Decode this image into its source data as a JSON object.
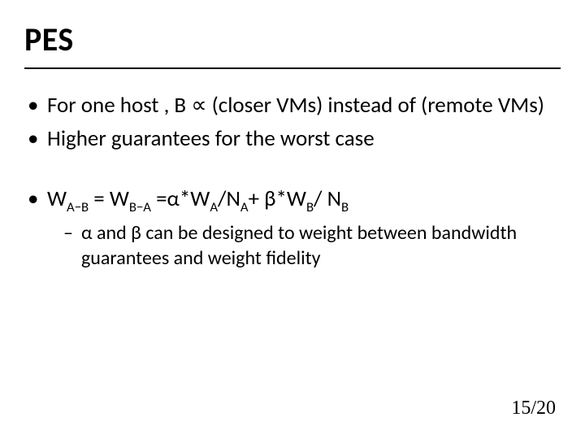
{
  "title": "PES",
  "bullets": {
    "b1_pre": "For one host , B ",
    "b1_sym": "∝",
    "b1_post": " (closer VMs) instead of (remote VMs)",
    "b2": "Higher guarantees for the worst case",
    "b3": {
      "W": "W",
      "AB": "A−B",
      "eq1": " = ",
      "BA": "B−A",
      "eq2": " =α*",
      "A": "A",
      "slashN": "/N",
      "plus": "+ β*",
      "B": "B",
      "slash": "/ N"
    },
    "sub1": "α and β can be designed to weight between bandwidth guarantees and weight fidelity"
  },
  "page": {
    "cur": "15",
    "sep": "/",
    "total": "20"
  }
}
